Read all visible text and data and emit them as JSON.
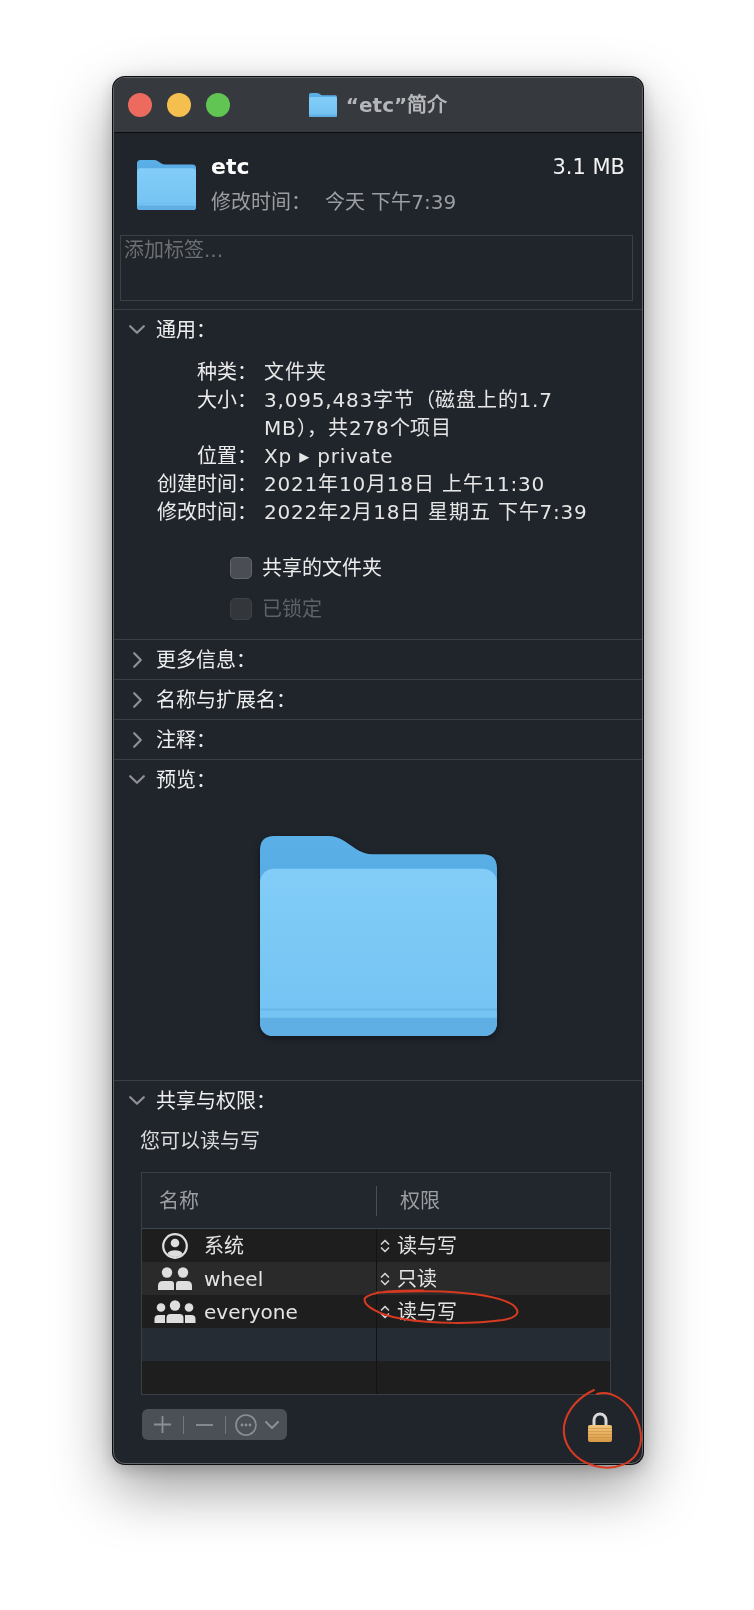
{
  "window": {
    "title": "“etc”简介"
  },
  "header": {
    "name": "etc",
    "size": "3.1 MB",
    "modified_label": "修改时间：",
    "modified_value": "今天 下午7:39"
  },
  "tags": {
    "placeholder": "添加标签..."
  },
  "sections": [
    {
      "kind": "general",
      "title": "通用：",
      "expanded": true,
      "rows": [
        {
          "label": "种类：",
          "value": "文件夹"
        },
        {
          "label": "大小：",
          "value": "3,095,483字节（磁盘上的1.7 MB），共278个项目"
        },
        {
          "label": "位置：",
          "value": "Xp ▸ private"
        },
        {
          "label": "创建时间：",
          "value": "2021年10月18日 上午11:30"
        },
        {
          "label": "修改时间：",
          "value": "2022年2月18日 星期五 下午7:39"
        }
      ],
      "checkboxes": [
        {
          "label": "共享的文件夹",
          "checked": false,
          "disabled": false
        },
        {
          "label": "已锁定",
          "checked": false,
          "disabled": true
        }
      ]
    },
    {
      "title": "更多信息：",
      "expanded": false
    },
    {
      "title": "名称与扩展名：",
      "expanded": false
    },
    {
      "title": "注释：",
      "expanded": false
    },
    {
      "kind": "preview",
      "title": "预览：",
      "expanded": true
    },
    {
      "kind": "sharing",
      "title": "共享与权限：",
      "expanded": true,
      "summary": "您可以读与写",
      "columns": [
        "名称",
        "权限"
      ],
      "rows": [
        {
          "name": "系统",
          "kind": "user",
          "privilege": "读与写",
          "circled": false
        },
        {
          "name": "wheel",
          "kind": "group",
          "privilege": "只读",
          "circled": false
        },
        {
          "name": "everyone",
          "kind": "everyone",
          "privilege": "读与写",
          "circled": true
        }
      ],
      "toolbar": {
        "disabled": true
      },
      "lock": {
        "locked": true,
        "circled": true
      }
    }
  ]
}
